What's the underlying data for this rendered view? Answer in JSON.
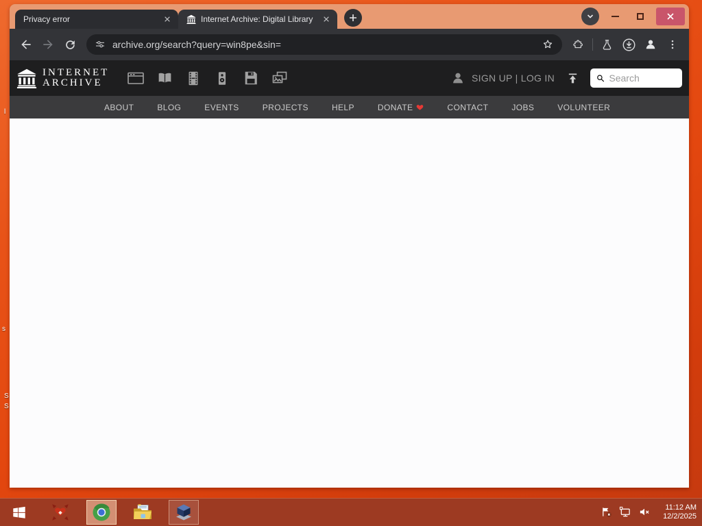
{
  "browser": {
    "tabs": [
      {
        "title": "Privacy error",
        "active": false
      },
      {
        "title": "Internet Archive: Digital Library",
        "active": true
      }
    ],
    "address_bar": {
      "url": "archive.org/search?query=win8pe&sin="
    }
  },
  "ia_site": {
    "logo": {
      "line1": "INTERNET",
      "line2": "ARCHIVE"
    },
    "media_types": [
      "web",
      "texts",
      "video",
      "audio",
      "software",
      "images"
    ],
    "auth_text": "SIGN UP | LOG IN",
    "search": {
      "placeholder": "Search"
    },
    "nav": [
      "ABOUT",
      "BLOG",
      "EVENTS",
      "PROJECTS",
      "HELP",
      "DONATE",
      "CONTACT",
      "JOBS",
      "VOLUNTEER"
    ]
  },
  "taskbar": {
    "clock": {
      "time": "11:12 AM",
      "date": "12/2/2025"
    },
    "apps": [
      "start",
      "red-app",
      "chrome",
      "file-explorer",
      "virtualbox"
    ],
    "tray": [
      "action-center",
      "network",
      "volume-muted"
    ]
  },
  "desktop": {
    "fragments": [
      "l",
      "s",
      "S",
      "S"
    ]
  },
  "colors": {
    "desktop_orange": "#e3470f",
    "frame_salmon": "#e89a72",
    "close_button": "#c9556a",
    "toolbar_bg": "#333438",
    "omnibox_bg": "#202124",
    "ia_header_bg": "#1e1e1f",
    "ia_nav_bg": "#3b3b3d",
    "taskbar_bg": "#9d3a22",
    "donate_heart": "#e53935",
    "content_bg": "#fcfcfd"
  }
}
